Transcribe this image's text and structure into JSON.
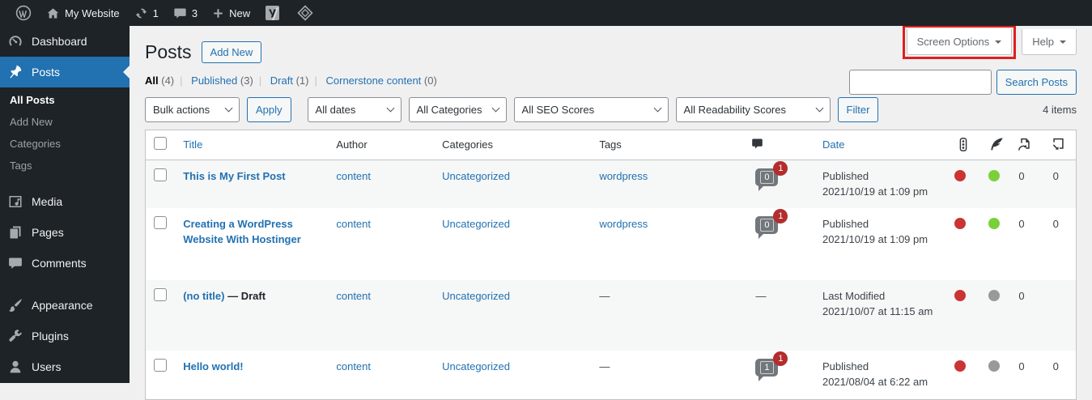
{
  "admin_bar": {
    "site_name": "My Website",
    "update_count": "1",
    "comment_count": "3",
    "new_label": "New"
  },
  "sidebar": {
    "dashboard": "Dashboard",
    "posts": "Posts",
    "submenu": {
      "all_posts": "All Posts",
      "add_new": "Add New",
      "categories": "Categories",
      "tags": "Tags"
    },
    "media": "Media",
    "pages": "Pages",
    "comments": "Comments",
    "appearance": "Appearance",
    "plugins": "Plugins",
    "users": "Users"
  },
  "page": {
    "title": "Posts",
    "add_new": "Add New",
    "screen_options": "Screen Options",
    "help": "Help"
  },
  "views": [
    {
      "label": "All",
      "count": "(4)"
    },
    {
      "label": "Published",
      "count": "(3)"
    },
    {
      "label": "Draft",
      "count": "(1)"
    },
    {
      "label": "Cornerstone content",
      "count": "(0)"
    }
  ],
  "toolbar": {
    "bulk_actions": "Bulk actions",
    "apply": "Apply",
    "all_dates": "All dates",
    "all_categories": "All Categories",
    "all_seo_scores": "All SEO Scores",
    "all_readability_scores": "All Readability Scores",
    "filter": "Filter",
    "items_count": "4 items"
  },
  "search": {
    "button": "Search Posts",
    "value": ""
  },
  "table": {
    "headers": {
      "title": "Title",
      "author": "Author",
      "categories": "Categories",
      "tags": "Tags",
      "date": "Date"
    },
    "rows": [
      {
        "title": "This is My First Post",
        "author": "content",
        "category": "Uncategorized",
        "tag": "wordpress",
        "comments_approved": "0",
        "comments_pending": "1",
        "date_status": "Published",
        "date_value": "2021/10/19 at 1:09 pm",
        "seo_score": "red",
        "readability_score": "green",
        "outgoing_links": "0",
        "incoming_links": "0"
      },
      {
        "title": "Creating a WordPress Website With Hostinger",
        "author": "content",
        "category": "Uncategorized",
        "tag": "wordpress",
        "comments_approved": "0",
        "comments_pending": "1",
        "date_status": "Published",
        "date_value": "2021/10/19 at 1:09 pm",
        "seo_score": "red",
        "readability_score": "green",
        "outgoing_links": "0",
        "incoming_links": "0"
      },
      {
        "title": "(no title)",
        "title_state": "— Draft",
        "author": "content",
        "category": "Uncategorized",
        "tag": "—",
        "comments": "—",
        "date_status": "Last Modified",
        "date_value": "2021/10/07 at 11:15 am",
        "seo_score": "red",
        "readability_score": "gray",
        "outgoing_links": "0",
        "incoming_links": ""
      },
      {
        "title": "Hello world!",
        "author": "content",
        "category": "Uncategorized",
        "tag": "—",
        "comments_approved": "1",
        "comments_pending": "1",
        "date_status": "Published",
        "date_value": "2021/08/04 at 6:22 am",
        "seo_score": "red",
        "readability_score": "gray",
        "outgoing_links": "0",
        "incoming_links": "0"
      }
    ]
  },
  "colors": {
    "accent": "#2271b1",
    "seo_red": "#ca3433",
    "seo_green": "#7ad03a",
    "seo_gray": "#999999",
    "pending_badge": "#b32d2e",
    "highlight_box": "#e01e1e",
    "admin_dark": "#1d2327"
  }
}
